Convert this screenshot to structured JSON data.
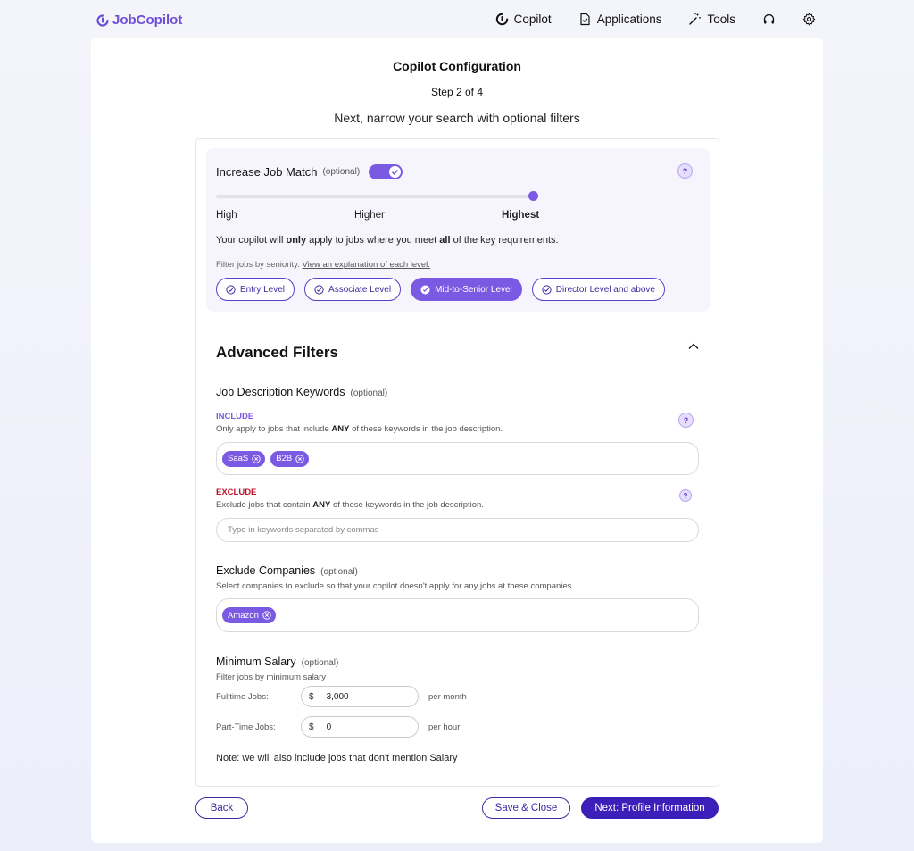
{
  "brand": {
    "name": "JobCopilot",
    "color": "#6d4fd8"
  },
  "nav": {
    "copilot": "Copilot",
    "applications": "Applications",
    "tools": "Tools"
  },
  "page": {
    "title": "Copilot Configuration",
    "step": "Step 2 of 4",
    "subtitle": "Next, narrow your search with optional filters"
  },
  "job_match": {
    "label": "Increase Job Match",
    "optional": "(optional)",
    "enabled": true,
    "levels": [
      "High",
      "Higher",
      "Highest"
    ],
    "selected_level": "Highest",
    "description_parts": [
      "Your copilot will ",
      "only",
      " apply to jobs where you meet ",
      "all",
      " of the key requirements."
    ],
    "seniority_note": "Filter jobs by seniority.",
    "seniority_link": "View an explanation of each level.",
    "seniority": [
      {
        "label": "Entry Level",
        "selected": false
      },
      {
        "label": "Associate Level",
        "selected": false
      },
      {
        "label": "Mid-to-Senior Level",
        "selected": true
      },
      {
        "label": "Director Level and above",
        "selected": false
      }
    ]
  },
  "advanced": {
    "title": "Advanced Filters",
    "keywords": {
      "label": "Job Description Keywords",
      "optional": "(optional)",
      "include_label": "INCLUDE",
      "include_desc_parts": [
        "Only apply to jobs that include ",
        "ANY",
        " of these keywords in the job description."
      ],
      "include_tags": [
        "SaaS",
        "B2B"
      ],
      "exclude_label": "EXCLUDE",
      "exclude_desc_parts": [
        "Exclude jobs that contain ",
        "ANY",
        " of these keywords in the job description."
      ],
      "exclude_placeholder": "Type in keywords separated by commas"
    },
    "companies": {
      "label": "Exclude Companies",
      "optional": "(optional)",
      "desc": "Select companies to exclude so that your copilot doesn't apply for any jobs at these companies.",
      "tags": [
        "Amazon"
      ]
    },
    "salary": {
      "label": "Minimum Salary",
      "optional": "(optional)",
      "desc": "Filter jobs by minimum salary",
      "fulltime_label": "Fulltime Jobs:",
      "fulltime_value": "3,000",
      "fulltime_unit": "per month",
      "parttime_label": "Part-Time Jobs:",
      "parttime_value": "0",
      "parttime_unit": "per hour",
      "currency": "$",
      "note": "Note: we will also include jobs that don't mention Salary"
    }
  },
  "footer": {
    "back": "Back",
    "save": "Save & Close",
    "next": "Next: Profile Information"
  },
  "help_glyph": "?"
}
